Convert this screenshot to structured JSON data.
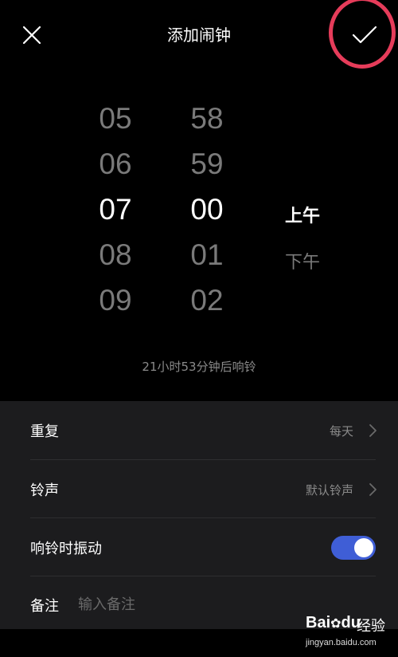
{
  "header": {
    "title": "添加闹钟",
    "close_icon": "close-icon",
    "confirm_icon": "check-icon",
    "highlight_color": "#e63c5a"
  },
  "picker": {
    "hours": [
      "05",
      "06",
      "07",
      "08",
      "09"
    ],
    "minutes": [
      "58",
      "59",
      "00",
      "01",
      "02"
    ],
    "selected_hour": "07",
    "selected_minute": "00",
    "am_pm": [
      "上午",
      "下午"
    ],
    "selected_am_pm": "上午"
  },
  "countdown": "21小时53分钟后响铃",
  "settings": {
    "repeat": {
      "label": "重复",
      "value": "每天"
    },
    "ringtone": {
      "label": "铃声",
      "value": "默认铃声"
    },
    "vibrate": {
      "label": "响铃时振动",
      "enabled": true,
      "color": "#3f5ed6"
    },
    "note": {
      "label": "备注",
      "placeholder": "输入备注",
      "value": ""
    }
  },
  "watermark": {
    "logo": "Bai",
    "logo2": "du",
    "jingyan": "经验",
    "url": "jingyan.baidu.com"
  }
}
